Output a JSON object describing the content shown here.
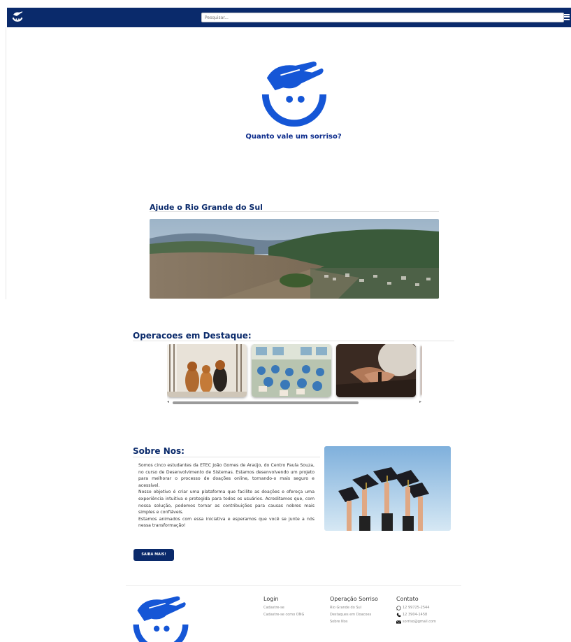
{
  "header": {
    "search_placeholder": "Pesquisar..."
  },
  "hero": {
    "tagline": "Quanto vale um sorriso?"
  },
  "rio_grande": {
    "title": "Ajude o Rio Grande do Sul"
  },
  "operacoes": {
    "title": "Operacoes em Destaque:",
    "cards": [
      "dogs",
      "classroom",
      "elderly-hands"
    ]
  },
  "sobre": {
    "title": "Sobre Nos:",
    "paragraphs": [
      "Somos cinco estudantes da ETEC João Gomes de Araújo, do Centro Paula Souza, no curso de Desenvolvimento de Sistemas. Estamos desenvolvendo um projeto para melhorar o processo de doações online, tornando-o mais seguro e acessível.",
      "Nosso objetivo é criar uma plataforma que facilite as doações e ofereça uma experiência intuitiva e protegida para todos os usuários. Acreditamos que, com nossa solução, podemos tornar as contribuições para causas nobres mais simples e confiáveis.",
      "Estamos animados com essa iniciativa e esperamos que você se junte a nós nessa transformação!"
    ],
    "button_label": "SAIBA MAIS!"
  },
  "footer": {
    "col1": {
      "heading": "Login",
      "links": [
        "Cadastre-se",
        "Cadastre-se como ONG"
      ]
    },
    "col2": {
      "heading": "Operação Sorriso",
      "links": [
        "Rio Grande do Sul",
        "Destaques em Doacoes",
        "Sobre Nos"
      ]
    },
    "col3": {
      "heading": "Contato",
      "whatsapp": "12 99725-2544",
      "phone": "12 3904-1458",
      "email": "sorriso@gmail.com"
    }
  },
  "colors": {
    "navy": "#0a2a6b",
    "brand_blue": "#1556d6"
  }
}
